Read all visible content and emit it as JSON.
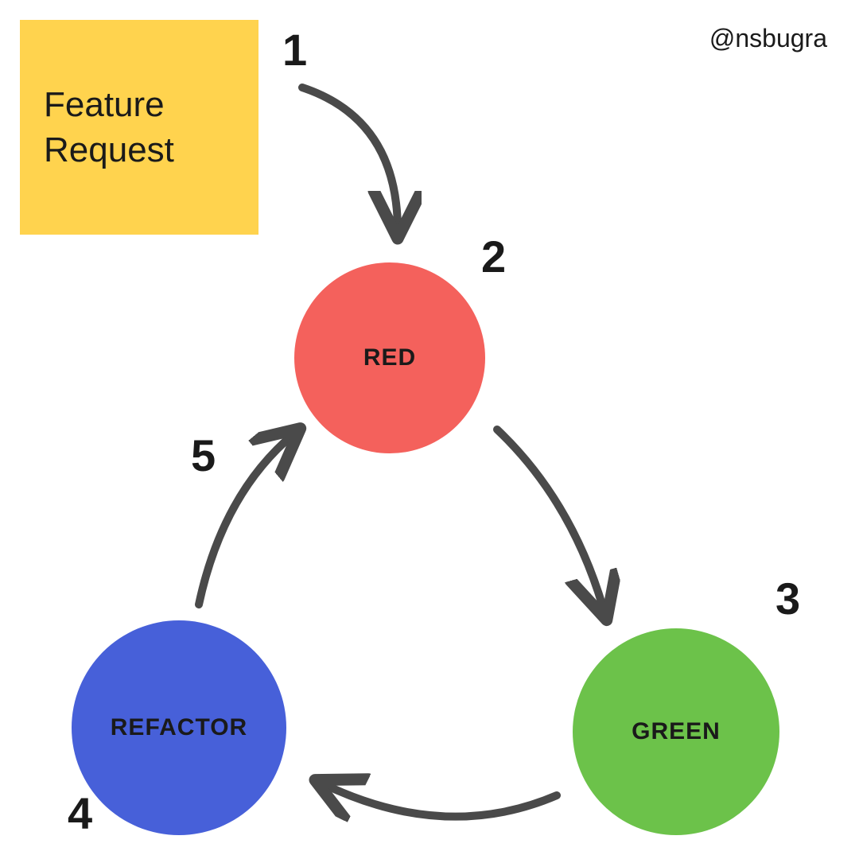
{
  "attribution": "@nsbugra",
  "sticky_note": {
    "line1": "Feature",
    "line2": "Request"
  },
  "nodes": {
    "red": {
      "label": "RED",
      "color": "#f4615c"
    },
    "green": {
      "label": "GREEN",
      "color": "#6cc24a"
    },
    "refactor": {
      "label": "REFACTOR",
      "color": "#4760d9"
    }
  },
  "steps": {
    "s1": "1",
    "s2": "2",
    "s3": "3",
    "s4": "4",
    "s5": "5"
  },
  "flow": [
    {
      "step": 1,
      "from": "Feature Request",
      "to": "RED"
    },
    {
      "step": 2,
      "node": "RED"
    },
    {
      "step": 3,
      "node": "GREEN"
    },
    {
      "step": 4,
      "node": "REFACTOR"
    },
    {
      "step": 5,
      "from": "REFACTOR",
      "to": "RED"
    }
  ]
}
